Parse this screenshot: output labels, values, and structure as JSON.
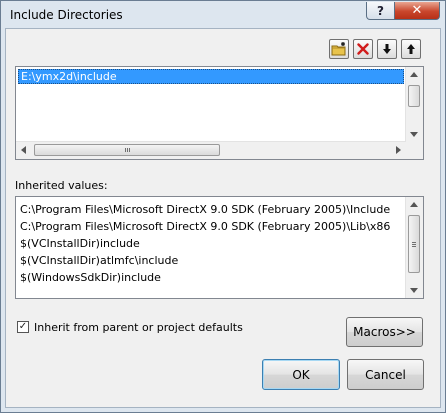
{
  "window": {
    "title": "Include Directories",
    "help_label": "?",
    "close_label": "✕"
  },
  "toolbar": {
    "icons": [
      "new-folder-icon",
      "delete-icon",
      "move-down-icon",
      "move-up-icon"
    ]
  },
  "directories": {
    "items": [
      "E:\\ymx2d\\include"
    ]
  },
  "inherited": {
    "label": "Inherited values:",
    "items": [
      "C:\\Program Files\\Microsoft DirectX 9.0 SDK (February 2005)\\Include",
      "C:\\Program Files\\Microsoft DirectX 9.0 SDK (February 2005)\\Lib\\x86",
      "$(VCInstallDir)include",
      "$(VCInstallDir)atlmfc\\include",
      "$(WindowsSdkDir)include"
    ]
  },
  "inherit_checkbox": {
    "label": "Inherit from parent or project defaults",
    "checked": true
  },
  "buttons": {
    "macros": "Macros>>",
    "ok": "OK",
    "cancel": "Cancel"
  },
  "colors": {
    "selection": "#3399ff",
    "close_button": "#c9462c"
  }
}
